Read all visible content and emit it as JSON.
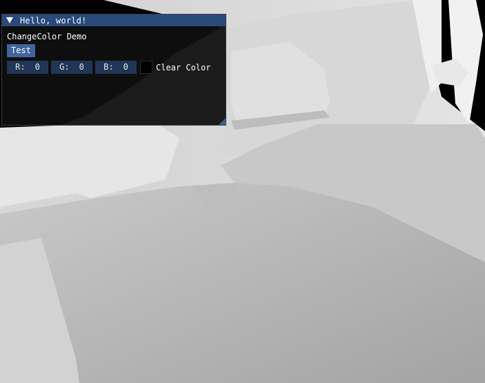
{
  "window": {
    "title": "Hello, world!",
    "collapse_icon": "triangle-down-icon",
    "demo_label": "ChangeColor Demo",
    "test_button_label": "Test",
    "channels": [
      {
        "label": "R:",
        "value": "0"
      },
      {
        "label": "G:",
        "value": "0"
      },
      {
        "label": "B:",
        "value": "0"
      }
    ],
    "swatch_color": "#000000",
    "clear_color_label": "Clear Color"
  },
  "colors": {
    "title_bar": "#294a7a",
    "button": "#42639c",
    "frame_bg": "#213556",
    "window_bg": "#0f0f0f"
  }
}
